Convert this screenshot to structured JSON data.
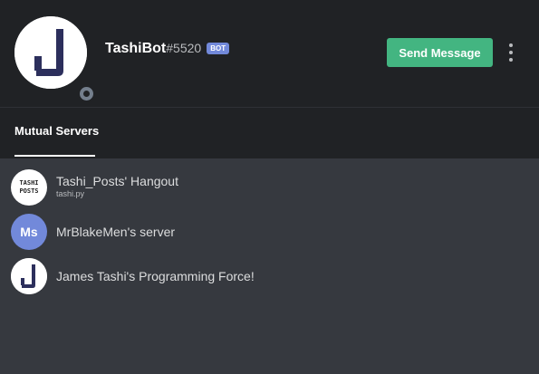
{
  "profile": {
    "username": "TashiBot",
    "discriminator": "#5520",
    "bot_tag": "BOT",
    "avatar_icon": "letter-j-avatar",
    "status": "offline"
  },
  "actions": {
    "send_message_label": "Send Message",
    "more_icon": "vertical-ellipsis-icon"
  },
  "tabs": [
    {
      "label": "Mutual Servers",
      "active": true
    }
  ],
  "servers": [
    {
      "name": "Tashi_Posts' Hangout",
      "subtitle": "tashi.py",
      "icon_lines": [
        "TASHI",
        "POSTS"
      ]
    },
    {
      "name": "MrBlakeMen's server",
      "icon_text": "Ms"
    },
    {
      "name": "James Tashi's Programming Force!",
      "icon": "letter-j-icon"
    }
  ],
  "colors": {
    "header_bg": "#202225",
    "body_bg": "#36393f",
    "send_button": "#43b581",
    "bot_tag": "#7289da",
    "server_ms_icon": "#7289da"
  }
}
